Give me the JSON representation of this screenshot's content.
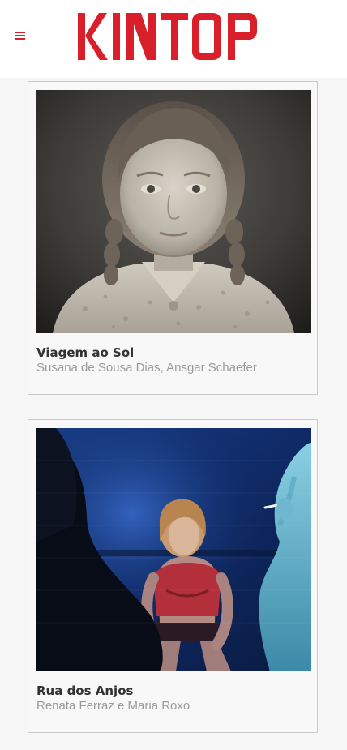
{
  "header": {
    "logo_text": "KINTOP",
    "menu_icon": "hamburger-menu-icon",
    "brand_color": "#d9202a"
  },
  "films": [
    {
      "title": "Viagem ao Sol",
      "authors": "Susana de Sousa Dias, Ansgar Schaefer",
      "image": "black-and-white portrait of a young girl with braids"
    },
    {
      "title": "Rua dos Anjos",
      "authors": "Renata Ferraz e Maria Roxo",
      "image": "blue-lit scene of a woman in red sitting, another woman smoking"
    }
  ]
}
